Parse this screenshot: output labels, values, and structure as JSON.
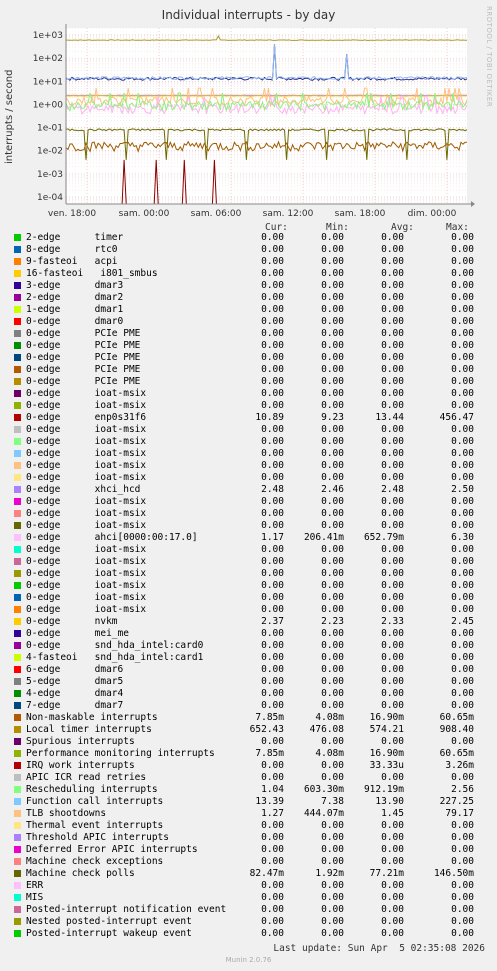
{
  "title": "Individual interrupts - by day",
  "side_label": "RRDTOOL / TOBI OETIKER",
  "footer": {
    "last_update": "Last update: Sun Apr  5 02:35:08 2026",
    "version": "Munin 2.0.76"
  },
  "headers": {
    "cur": "Cur:",
    "min": "Min:",
    "avg": "Avg:",
    "max": "Max:"
  },
  "chart_data": {
    "type": "line",
    "title": "Individual interrupts - by day",
    "ylabel": "interrupts / second",
    "yscale": "log",
    "ylim": [
      5e-05,
      2000
    ],
    "yticks": [
      "1e+03",
      "1e+02",
      "1e+01",
      "1e+00",
      "1e-01",
      "1e-02",
      "1e-03",
      "1e-04"
    ],
    "xticks": [
      "ven. 18:00",
      "sam. 00:00",
      "sam. 06:00",
      "sam. 12:00",
      "sam. 18:00",
      "dim. 00:00"
    ],
    "grid": true,
    "series": [
      {
        "name": "Local timer interrupts",
        "color": "#A89A28",
        "level": 600
      },
      {
        "name": "enp0s31f6",
        "color": "#2A2A8C",
        "level": 13
      },
      {
        "name": "Function call interrupts",
        "color": "#8FB8F0",
        "level": 13.9
      },
      {
        "name": "xhci_hcd",
        "color": "#B088F0",
        "level": 2.48
      },
      {
        "name": "nvkm",
        "color": "#F2C200",
        "level": 2.33
      },
      {
        "name": "TLB shootdowns",
        "color": "#FFC080",
        "level": 1.45
      },
      {
        "name": "ahci[0000:00:17.0]",
        "color": "#FFB3F0",
        "level": 0.65
      },
      {
        "name": "Rescheduling interrupts",
        "color": "#90F080",
        "level": 0.9
      },
      {
        "name": "Machine check polls",
        "color": "#6B6B00",
        "level": 0.08
      },
      {
        "name": "Non-maskable interrupts",
        "color": "#A05A00",
        "level": 0.017
      },
      {
        "name": "IRQ work interrupts",
        "color": "#8A0000",
        "level": 3e-05
      }
    ]
  },
  "rows": [
    {
      "color": "#00CC00",
      "label": "2-edge      timer",
      "cur": "0.00",
      "min": "0.00",
      "avg": "0.00",
      "max": "0.00"
    },
    {
      "color": "#0066B3",
      "label": "8-edge      rtc0",
      "cur": "0.00",
      "min": "0.00",
      "avg": "0.00",
      "max": "0.00"
    },
    {
      "color": "#FF8000",
      "label": "9-fasteoi   acpi",
      "cur": "0.00",
      "min": "0.00",
      "avg": "0.00",
      "max": "0.00"
    },
    {
      "color": "#FFCC00",
      "label": "16-fasteoi   i801_smbus",
      "cur": "0.00",
      "min": "0.00",
      "avg": "0.00",
      "max": "0.00"
    },
    {
      "color": "#330099",
      "label": "3-edge      dmar3",
      "cur": "0.00",
      "min": "0.00",
      "avg": "0.00",
      "max": "0.00"
    },
    {
      "color": "#990099",
      "label": "2-edge      dmar2",
      "cur": "0.00",
      "min": "0.00",
      "avg": "0.00",
      "max": "0.00"
    },
    {
      "color": "#CCFF00",
      "label": "1-edge      dmar1",
      "cur": "0.00",
      "min": "0.00",
      "avg": "0.00",
      "max": "0.00"
    },
    {
      "color": "#FF0000",
      "label": "0-edge      dmar0",
      "cur": "0.00",
      "min": "0.00",
      "avg": "0.00",
      "max": "0.00"
    },
    {
      "color": "#808080",
      "label": "0-edge      PCIe PME",
      "cur": "0.00",
      "min": "0.00",
      "avg": "0.00",
      "max": "0.00"
    },
    {
      "color": "#008F00",
      "label": "0-edge      PCIe PME",
      "cur": "0.00",
      "min": "0.00",
      "avg": "0.00",
      "max": "0.00"
    },
    {
      "color": "#00487D",
      "label": "0-edge      PCIe PME",
      "cur": "0.00",
      "min": "0.00",
      "avg": "0.00",
      "max": "0.00"
    },
    {
      "color": "#B35A00",
      "label": "0-edge      PCIe PME",
      "cur": "0.00",
      "min": "0.00",
      "avg": "0.00",
      "max": "0.00"
    },
    {
      "color": "#B38F00",
      "label": "0-edge      PCIe PME",
      "cur": "0.00",
      "min": "0.00",
      "avg": "0.00",
      "max": "0.00"
    },
    {
      "color": "#6B006B",
      "label": "0-edge      ioat-msix",
      "cur": "0.00",
      "min": "0.00",
      "avg": "0.00",
      "max": "0.00"
    },
    {
      "color": "#8FB300",
      "label": "0-edge      ioat-msix",
      "cur": "0.00",
      "min": "0.00",
      "avg": "0.00",
      "max": "0.00"
    },
    {
      "color": "#B30000",
      "label": "0-edge      enp0s31f6",
      "cur": "10.89",
      "min": "9.23",
      "avg": "13.44",
      "max": "456.47"
    },
    {
      "color": "#BEBEBE",
      "label": "0-edge      ioat-msix",
      "cur": "0.00",
      "min": "0.00",
      "avg": "0.00",
      "max": "0.00"
    },
    {
      "color": "#80FF80",
      "label": "0-edge      ioat-msix",
      "cur": "0.00",
      "min": "0.00",
      "avg": "0.00",
      "max": "0.00"
    },
    {
      "color": "#80C9FF",
      "label": "0-edge      ioat-msix",
      "cur": "0.00",
      "min": "0.00",
      "avg": "0.00",
      "max": "0.00"
    },
    {
      "color": "#FFC080",
      "label": "0-edge      ioat-msix",
      "cur": "0.00",
      "min": "0.00",
      "avg": "0.00",
      "max": "0.00"
    },
    {
      "color": "#FFE680",
      "label": "0-edge      ioat-msix",
      "cur": "0.00",
      "min": "0.00",
      "avg": "0.00",
      "max": "0.00"
    },
    {
      "color": "#AA80FF",
      "label": "0-edge      xhci_hcd",
      "cur": "2.48",
      "min": "2.46",
      "avg": "2.48",
      "max": "2.50"
    },
    {
      "color": "#EE00CC",
      "label": "0-edge      ioat-msix",
      "cur": "0.00",
      "min": "0.00",
      "avg": "0.00",
      "max": "0.00"
    },
    {
      "color": "#FF8080",
      "label": "0-edge      ioat-msix",
      "cur": "0.00",
      "min": "0.00",
      "avg": "0.00",
      "max": "0.00"
    },
    {
      "color": "#666600",
      "label": "0-edge      ioat-msix",
      "cur": "0.00",
      "min": "0.00",
      "avg": "0.00",
      "max": "0.00"
    },
    {
      "color": "#FFBFFF",
      "label": "0-edge      ahci[0000:00:17.0]",
      "cur": "1.17",
      "min": "206.41m",
      "avg": "652.79m",
      "max": "6.30"
    },
    {
      "color": "#00FFCC",
      "label": "0-edge      ioat-msix",
      "cur": "0.00",
      "min": "0.00",
      "avg": "0.00",
      "max": "0.00"
    },
    {
      "color": "#CC6699",
      "label": "0-edge      ioat-msix",
      "cur": "0.00",
      "min": "0.00",
      "avg": "0.00",
      "max": "0.00"
    },
    {
      "color": "#999900",
      "label": "0-edge      ioat-msix",
      "cur": "0.00",
      "min": "0.00",
      "avg": "0.00",
      "max": "0.00"
    },
    {
      "color": "#00CC00",
      "label": "0-edge      ioat-msix",
      "cur": "0.00",
      "min": "0.00",
      "avg": "0.00",
      "max": "0.00"
    },
    {
      "color": "#0066B3",
      "label": "0-edge      ioat-msix",
      "cur": "0.00",
      "min": "0.00",
      "avg": "0.00",
      "max": "0.00"
    },
    {
      "color": "#FF8000",
      "label": "0-edge      ioat-msix",
      "cur": "0.00",
      "min": "0.00",
      "avg": "0.00",
      "max": "0.00"
    },
    {
      "color": "#FFCC00",
      "label": "0-edge      nvkm",
      "cur": "2.37",
      "min": "2.23",
      "avg": "2.33",
      "max": "2.45"
    },
    {
      "color": "#330099",
      "label": "0-edge      mei_me",
      "cur": "0.00",
      "min": "0.00",
      "avg": "0.00",
      "max": "0.00"
    },
    {
      "color": "#990099",
      "label": "0-edge      snd_hda_intel:card0",
      "cur": "0.00",
      "min": "0.00",
      "avg": "0.00",
      "max": "0.00"
    },
    {
      "color": "#CCFF00",
      "label": "4-fasteoi   snd_hda_intel:card1",
      "cur": "0.00",
      "min": "0.00",
      "avg": "0.00",
      "max": "0.00"
    },
    {
      "color": "#FF0000",
      "label": "6-edge      dmar6",
      "cur": "0.00",
      "min": "0.00",
      "avg": "0.00",
      "max": "0.00"
    },
    {
      "color": "#808080",
      "label": "5-edge      dmar5",
      "cur": "0.00",
      "min": "0.00",
      "avg": "0.00",
      "max": "0.00"
    },
    {
      "color": "#008F00",
      "label": "4-edge      dmar4",
      "cur": "0.00",
      "min": "0.00",
      "avg": "0.00",
      "max": "0.00"
    },
    {
      "color": "#00487D",
      "label": "7-edge      dmar7",
      "cur": "0.00",
      "min": "0.00",
      "avg": "0.00",
      "max": "0.00"
    },
    {
      "color": "#B35A00",
      "label": "Non-maskable interrupts",
      "cur": "7.85m",
      "min": "4.08m",
      "avg": "16.90m",
      "max": "60.65m"
    },
    {
      "color": "#B38F00",
      "label": "Local timer interrupts",
      "cur": "652.43",
      "min": "476.08",
      "avg": "574.21",
      "max": "908.40"
    },
    {
      "color": "#6B006B",
      "label": "Spurious interrupts",
      "cur": "0.00",
      "min": "0.00",
      "avg": "0.00",
      "max": "0.00"
    },
    {
      "color": "#8FB300",
      "label": "Performance monitoring interrupts",
      "cur": "7.85m",
      "min": "4.08m",
      "avg": "16.90m",
      "max": "60.65m"
    },
    {
      "color": "#B30000",
      "label": "IRQ work interrupts",
      "cur": "0.00",
      "min": "0.00",
      "avg": "33.33u",
      "max": "3.26m"
    },
    {
      "color": "#BEBEBE",
      "label": "APIC ICR read retries",
      "cur": "0.00",
      "min": "0.00",
      "avg": "0.00",
      "max": "0.00"
    },
    {
      "color": "#80FF80",
      "label": "Rescheduling interrupts",
      "cur": "1.04",
      "min": "603.30m",
      "avg": "912.19m",
      "max": "2.56"
    },
    {
      "color": "#80C9FF",
      "label": "Function call interrupts",
      "cur": "13.39",
      "min": "7.38",
      "avg": "13.90",
      "max": "227.25"
    },
    {
      "color": "#FFC080",
      "label": "TLB shootdowns",
      "cur": "1.27",
      "min": "444.07m",
      "avg": "1.45",
      "max": "79.17"
    },
    {
      "color": "#FFE680",
      "label": "Thermal event interrupts",
      "cur": "0.00",
      "min": "0.00",
      "avg": "0.00",
      "max": "0.00"
    },
    {
      "color": "#AA80FF",
      "label": "Threshold APIC interrupts",
      "cur": "0.00",
      "min": "0.00",
      "avg": "0.00",
      "max": "0.00"
    },
    {
      "color": "#EE00CC",
      "label": "Deferred Error APIC interrupts",
      "cur": "0.00",
      "min": "0.00",
      "avg": "0.00",
      "max": "0.00"
    },
    {
      "color": "#FF8080",
      "label": "Machine check exceptions",
      "cur": "0.00",
      "min": "0.00",
      "avg": "0.00",
      "max": "0.00"
    },
    {
      "color": "#666600",
      "label": "Machine check polls",
      "cur": "82.47m",
      "min": "1.92m",
      "avg": "77.21m",
      "max": "146.50m"
    },
    {
      "color": "#FFBFFF",
      "label": "ERR",
      "cur": "0.00",
      "min": "0.00",
      "avg": "0.00",
      "max": "0.00"
    },
    {
      "color": "#00FFCC",
      "label": "MIS",
      "cur": "0.00",
      "min": "0.00",
      "avg": "0.00",
      "max": "0.00"
    },
    {
      "color": "#CC6699",
      "label": "Posted-interrupt notification event",
      "cur": "0.00",
      "min": "0.00",
      "avg": "0.00",
      "max": "0.00"
    },
    {
      "color": "#999900",
      "label": "Nested posted-interrupt event",
      "cur": "0.00",
      "min": "0.00",
      "avg": "0.00",
      "max": "0.00"
    },
    {
      "color": "#00CC00",
      "label": "Posted-interrupt wakeup event",
      "cur": "0.00",
      "min": "0.00",
      "avg": "0.00",
      "max": "0.00"
    }
  ]
}
